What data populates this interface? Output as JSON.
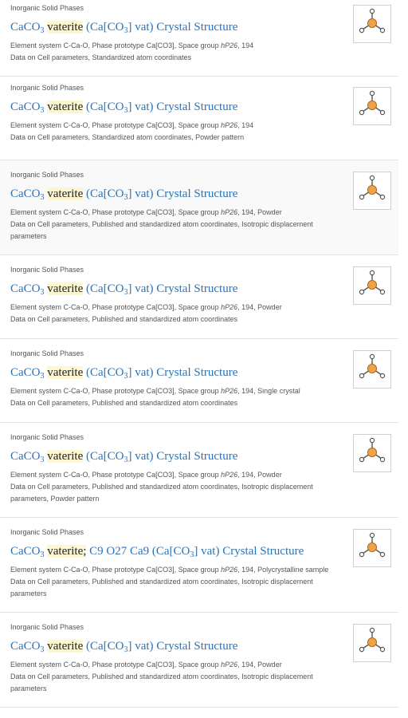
{
  "results": [
    {
      "category": "Inorganic Solid Phases",
      "title": {
        "f1": "CaCO",
        "s1": "3",
        "hl": "vaterite",
        "mid": "",
        "p1": "(Ca[CO",
        "s2": "3",
        "p2": "] vat) Crystal Structure"
      },
      "line1": {
        "pre": "Element system C-Ca-O, Phase prototype Ca[CO3], Space group ",
        "sg": "hP26",
        "post": ", 194"
      },
      "line2": "Data on Cell parameters, Standardized atom coordinates",
      "line3": "",
      "thumb_icon": "crystal-structure-icon"
    },
    {
      "category": "Inorganic Solid Phases",
      "title": {
        "f1": "CaCO",
        "s1": "3",
        "hl": "vaterite",
        "mid": "",
        "p1": "(Ca[CO",
        "s2": "3",
        "p2": "] vat) Crystal Structure"
      },
      "line1": {
        "pre": "Element system C-Ca-O, Phase prototype Ca[CO3], Space group ",
        "sg": "hP26",
        "post": ", 194"
      },
      "line2": "Data on Cell parameters, Standardized atom coordinates, Powder pattern",
      "line3": "",
      "thumb_icon": "crystal-structure-icon"
    },
    {
      "category": "Inorganic Solid Phases",
      "title": {
        "f1": "CaCO",
        "s1": "3",
        "hl": "vaterite",
        "mid": "",
        "p1": "(Ca[CO",
        "s2": "3",
        "p2": "] vat) Crystal Structure"
      },
      "line1": {
        "pre": "Element system C-Ca-O, Phase prototype Ca[CO3], Space group ",
        "sg": "hP26",
        "post": ", 194, Powder"
      },
      "line2": "Data on Cell parameters, Published and standardized atom coordinates, Isotropic displacement",
      "line3": "parameters",
      "thumb_icon": "crystal-structure-icon"
    },
    {
      "category": "Inorganic Solid Phases",
      "title": {
        "f1": "CaCO",
        "s1": "3",
        "hl": "vaterite",
        "mid": "",
        "p1": "(Ca[CO",
        "s2": "3",
        "p2": "] vat) Crystal Structure"
      },
      "line1": {
        "pre": "Element system C-Ca-O, Phase prototype Ca[CO3], Space group ",
        "sg": "hP26",
        "post": ", 194, Powder"
      },
      "line2": "Data on Cell parameters, Published and standardized atom coordinates",
      "line3": "",
      "thumb_icon": "crystal-structure-icon"
    },
    {
      "category": "Inorganic Solid Phases",
      "title": {
        "f1": "CaCO",
        "s1": "3",
        "hl": "vaterite",
        "mid": "",
        "p1": "(Ca[CO",
        "s2": "3",
        "p2": "] vat) Crystal Structure"
      },
      "line1": {
        "pre": "Element system C-Ca-O, Phase prototype Ca[CO3], Space group ",
        "sg": "hP26",
        "post": ", 194, Single crystal"
      },
      "line2": "Data on Cell parameters, Published and standardized atom coordinates",
      "line3": "",
      "thumb_icon": "crystal-structure-icon"
    },
    {
      "category": "Inorganic Solid Phases",
      "title": {
        "f1": "CaCO",
        "s1": "3",
        "hl": "vaterite",
        "mid": "",
        "p1": "(Ca[CO",
        "s2": "3",
        "p2": "] vat) Crystal Structure"
      },
      "line1": {
        "pre": "Element system C-Ca-O, Phase prototype Ca[CO3], Space group ",
        "sg": "hP26",
        "post": ", 194, Powder"
      },
      "line2": "Data on Cell parameters, Published and standardized atom coordinates, Isotropic displacement",
      "line3": "parameters, Powder pattern",
      "thumb_icon": "crystal-structure-icon"
    },
    {
      "category": "Inorganic Solid Phases",
      "title": {
        "f1": "CaCO",
        "s1": "3",
        "hl": "vaterite;",
        "mid": "C9 O27 Ca9",
        "p1": "(Ca[CO",
        "s2": "3",
        "p2": "] vat) Crystal Structure"
      },
      "line1": {
        "pre": "Element system C-Ca-O, Phase prototype Ca[CO3], Space group ",
        "sg": "hP26",
        "post": ", 194, Polycrystalline sample"
      },
      "line2": "Data on Cell parameters, Published and standardized atom coordinates, Isotropic displacement",
      "line3": "parameters",
      "thumb_icon": "crystal-structure-icon"
    },
    {
      "category": "Inorganic Solid Phases",
      "title": {
        "f1": "CaCO",
        "s1": "3",
        "hl": "vaterite",
        "mid": "",
        "p1": "(Ca[CO",
        "s2": "3",
        "p2": "] vat) Crystal Structure"
      },
      "line1": {
        "pre": "Element system C-Ca-O, Phase prototype Ca[CO3], Space group ",
        "sg": "hP26",
        "post": ", 194, Powder"
      },
      "line2": "Data on Cell parameters, Published and standardized atom coordinates, Isotropic displacement",
      "line3": "parameters",
      "thumb_icon": "crystal-structure-icon"
    }
  ],
  "colors": {
    "link": "#2b73b7",
    "highlight": "#fdf6d3",
    "atom_center": "#f0a24a",
    "atom_edge": "#a86a1c"
  }
}
